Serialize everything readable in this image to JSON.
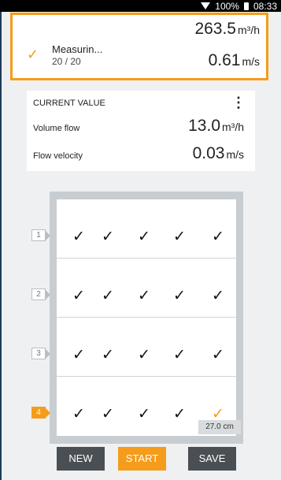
{
  "status": {
    "battery": "100%",
    "time": "08:33"
  },
  "summary": {
    "name": "Measurin...",
    "count": "20 / 20",
    "value1": "263.5",
    "unit1": "m³/h",
    "value2": "0.61",
    "unit2": "m/s"
  },
  "current": {
    "title": "CURRENT VALUE",
    "menu_icon": "⋮",
    "rows": [
      {
        "label": "Volume flow",
        "value": "13.0",
        "unit": "m³/h"
      },
      {
        "label": "Flow velocity",
        "value": "0.03",
        "unit": "m/s"
      }
    ]
  },
  "grid": {
    "rows": [
      {
        "label": "1",
        "active": false
      },
      {
        "label": "2",
        "active": false
      },
      {
        "label": "3",
        "active": false
      },
      {
        "label": "4",
        "active": true
      }
    ],
    "columns": 5,
    "check_glyph": "✓",
    "distance": "27.0 cm"
  },
  "buttons": {
    "new": "NEW",
    "start": "START",
    "save": "SAVE"
  },
  "colors": {
    "accent": "#f59c1a",
    "dark_button": "#4a4f54",
    "frame": "#c8cdd2"
  }
}
